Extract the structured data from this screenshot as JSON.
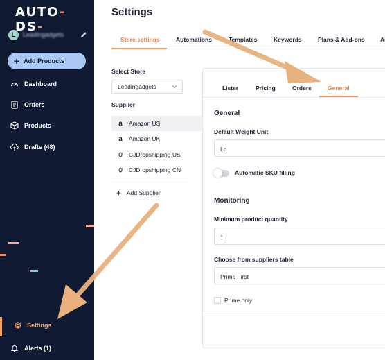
{
  "app": {
    "logo_part1": "AUT",
    "logo_part2": "O",
    "logo_sep": "-",
    "logo_part3": "DS",
    "logo_trail": "-"
  },
  "sidebar": {
    "avatar_initial": "L",
    "account_name": "Leadingadgets",
    "add_products_label": "Add Products",
    "items": [
      {
        "label": "Dashboard",
        "icon": "dashboard-icon"
      },
      {
        "label": "Orders",
        "icon": "orders-icon"
      },
      {
        "label": "Products",
        "icon": "box-icon"
      },
      {
        "label": "Drafts (48)",
        "icon": "cloud-upload-icon"
      }
    ],
    "settings_label": "Settings",
    "alerts_label": "Alerts (1)",
    "colors": {
      "background": "#101a33",
      "accent": "#f3a86b",
      "add_button": "#aac9f4"
    }
  },
  "main": {
    "title": "Settings",
    "tabs": [
      {
        "label": "Store settings",
        "active": true
      },
      {
        "label": "Automations",
        "active": false
      },
      {
        "label": "Templates",
        "active": false
      },
      {
        "label": "Keywords",
        "active": false
      },
      {
        "label": "Plans & Add-ons",
        "active": false
      },
      {
        "label": "Ac",
        "active": false
      }
    ],
    "select_store_label": "Select Store",
    "store_value": "Leadingadgets",
    "supplier_label": "Supplier",
    "suppliers": [
      {
        "label": "Amazon US",
        "selected": true
      },
      {
        "label": "Amazon UK",
        "selected": false
      },
      {
        "label": "CJDropshipping US",
        "selected": false
      },
      {
        "label": "CJDropshipping CN",
        "selected": false
      }
    ],
    "add_supplier_label": "Add Supplier"
  },
  "panel": {
    "tabs": [
      {
        "label": "Lister",
        "active": false
      },
      {
        "label": "Pricing",
        "active": false
      },
      {
        "label": "Orders",
        "active": false
      },
      {
        "label": "General",
        "active": true
      }
    ],
    "general_title": "General",
    "weight_label": "Default Weight Unit",
    "weight_value": "Lb",
    "sku_toggle_label": "Automatic SKU filling",
    "sku_toggle_on": false,
    "monitoring_title": "Monitoring",
    "min_qty_label": "Minimum product quantity",
    "min_qty_value": "1",
    "suppliers_table_label": "Choose from suppliers table",
    "suppliers_table_value": "Prime First",
    "prime_only_label": "Prime only",
    "prime_only_checked": false,
    "accent_color": "#e8864b"
  }
}
